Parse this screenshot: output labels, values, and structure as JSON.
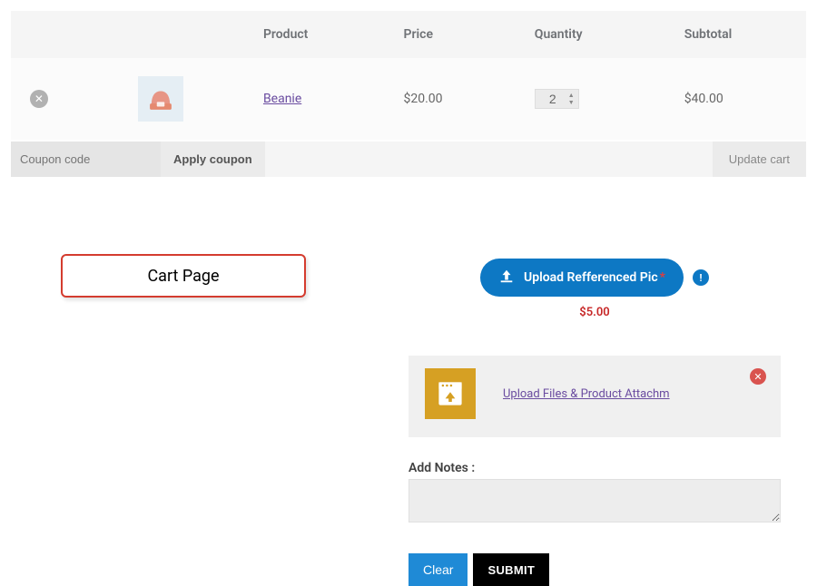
{
  "cart": {
    "headers": {
      "product": "Product",
      "price": "Price",
      "quantity": "Quantity",
      "subtotal": "Subtotal"
    },
    "item": {
      "name": "Beanie",
      "price": "$20.00",
      "quantity": "2",
      "subtotal": "$40.00",
      "thumb_color": "#e58e7b"
    },
    "coupon_placeholder": "Coupon code",
    "apply_coupon_label": "Apply coupon",
    "update_cart_label": "Update cart"
  },
  "annotation": {
    "label": "Cart Page"
  },
  "upload": {
    "button_label": "Upload Refferenced Pic",
    "required_marker": "*",
    "info_icon_glyph": "!",
    "price": "$5.00"
  },
  "attach": {
    "link_label": "Upload Files & Product Attachm",
    "close_glyph": "✕"
  },
  "notes": {
    "label": "Add Notes :"
  },
  "buttons": {
    "clear": "Clear",
    "submit": "SUBMIT"
  }
}
